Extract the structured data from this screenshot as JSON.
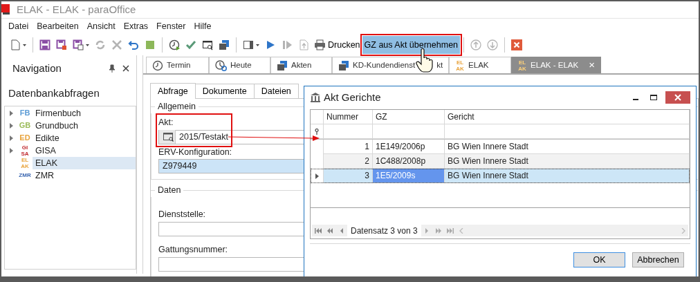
{
  "window": {
    "title": "ELAK - ELAK - paraOffice"
  },
  "menu": [
    "Datei",
    "Bearbeiten",
    "Ansicht",
    "Extras",
    "Fenster",
    "Hilfe"
  ],
  "toolbar": [
    {
      "kind": "icon",
      "disabled": false,
      "dropdown": true
    },
    {
      "kind": "separator"
    },
    {
      "kind": "icon",
      "disabled": false
    },
    {
      "kind": "icon",
      "disabled": false
    },
    {
      "kind": "icon",
      "disabled": false,
      "dropdown": true
    },
    {
      "kind": "icon",
      "disabled": true
    },
    {
      "kind": "icon",
      "disabled": true
    },
    {
      "kind": "icon",
      "disabled": false
    },
    {
      "kind": "icon",
      "disabled": false
    },
    {
      "kind": "separator"
    },
    {
      "kind": "icon",
      "disabled": false
    },
    {
      "kind": "icon",
      "disabled": false
    },
    {
      "kind": "icon",
      "disabled": false
    },
    {
      "kind": "icon",
      "disabled": false
    },
    {
      "kind": "separator"
    },
    {
      "kind": "icon",
      "disabled": false,
      "dropdown": true
    },
    {
      "kind": "icon",
      "disabled": false
    },
    {
      "kind": "icon",
      "disabled": true
    },
    {
      "kind": "icon",
      "disabled": true
    },
    {
      "kind": "print",
      "label": "Drucken"
    },
    {
      "kind": "button",
      "label": "GZ aus Akt übernehmen",
      "highlighted": true
    },
    {
      "kind": "separator"
    },
    {
      "kind": "icon",
      "disabled": true
    },
    {
      "kind": "icon",
      "disabled": true
    },
    {
      "kind": "separator"
    },
    {
      "kind": "icon",
      "disabled": false
    }
  ],
  "navigation": {
    "title": "Navigation",
    "heading": "Datenbankabfragen",
    "items": [
      {
        "badge_lines": [
          "FB"
        ],
        "color": "#5b9bd5",
        "label": "Firmenbuch",
        "expandable": true,
        "selected": false
      },
      {
        "badge_lines": [
          "GB"
        ],
        "color": "#9bbb59",
        "label": "Grundbuch",
        "expandable": true,
        "selected": false
      },
      {
        "badge_lines": [
          "ED"
        ],
        "color": "#e8a33c",
        "label": "Edikte",
        "expandable": true,
        "selected": false
      },
      {
        "badge_lines": [
          "GI",
          "SA"
        ],
        "color": "#c0282d",
        "label": "GISA",
        "expandable": true,
        "selected": false
      },
      {
        "badge_lines": [
          "EL",
          "AK"
        ],
        "color": "#e8a33c",
        "label": "ELAK",
        "expandable": false,
        "selected": true
      },
      {
        "badge_lines": [
          "ZMR"
        ],
        "color": "#3a66b0",
        "label": "ZMR",
        "expandable": false,
        "selected": false
      }
    ]
  },
  "doc_tabs": [
    {
      "kind": "clock",
      "label": "Termin",
      "selected": false
    },
    {
      "kind": "today",
      "label": "Heute",
      "selected": false
    },
    {
      "kind": "files",
      "label": "Akten",
      "selected": false
    },
    {
      "kind": "files",
      "label": "KD-Kundendienst",
      "label_tail": "kt",
      "selected": false
    },
    {
      "kind": "badge",
      "badge_lines": [
        "EL",
        "AK"
      ],
      "label": "ELAK",
      "selected": false
    },
    {
      "kind": "badge",
      "badge_lines": [
        "EL",
        "AK"
      ],
      "label": "ELAK - ELAK",
      "selected": true,
      "close": "×"
    }
  ],
  "inner_tabs": [
    {
      "label": "Abfrage",
      "selected": true
    },
    {
      "label": "Dokumente",
      "selected": false
    },
    {
      "label": "Dateien",
      "selected": false
    }
  ],
  "groups": [
    {
      "title": "Allgemein",
      "fields": [
        {
          "label": "Akt:",
          "value": "2015/Testakt",
          "kind": "lookup",
          "highlighted": false
        },
        {
          "label": "ERV-Konfiguration:",
          "value": "Z979449",
          "kind": "text",
          "highlighted": true
        }
      ]
    },
    {
      "title": "Daten",
      "fields": [
        {
          "label": "Dienststelle:",
          "kind": "text",
          "highlighted": false
        },
        {
          "label": "Gattungsnummer:",
          "kind": "text",
          "highlighted": false
        }
      ]
    }
  ],
  "dialog": {
    "title": "Akt Gerichte",
    "columns": [
      "Nummer",
      "GZ",
      "Gericht"
    ],
    "rows": [
      {
        "cells": [
          "1",
          "1E149/2006p",
          "BG Wien Innere Stadt"
        ],
        "focused_cells": [
          false,
          false,
          false
        ],
        "selected": false
      },
      {
        "cells": [
          "2",
          "1C488/2008p",
          "BG Wien Innere Stadt"
        ],
        "focused_cells": [
          false,
          false,
          false
        ],
        "selected": false
      },
      {
        "cells": [
          "3",
          "1E5/2009s",
          "BG Wien Innere Stadt"
        ],
        "focused_cells": [
          false,
          true,
          false
        ],
        "selected": true
      }
    ],
    "navigator": "Datensatz 3 von 3",
    "buttons": [
      {
        "label": "OK",
        "default": true
      },
      {
        "label": "Abbrechen",
        "default": false
      }
    ]
  }
}
